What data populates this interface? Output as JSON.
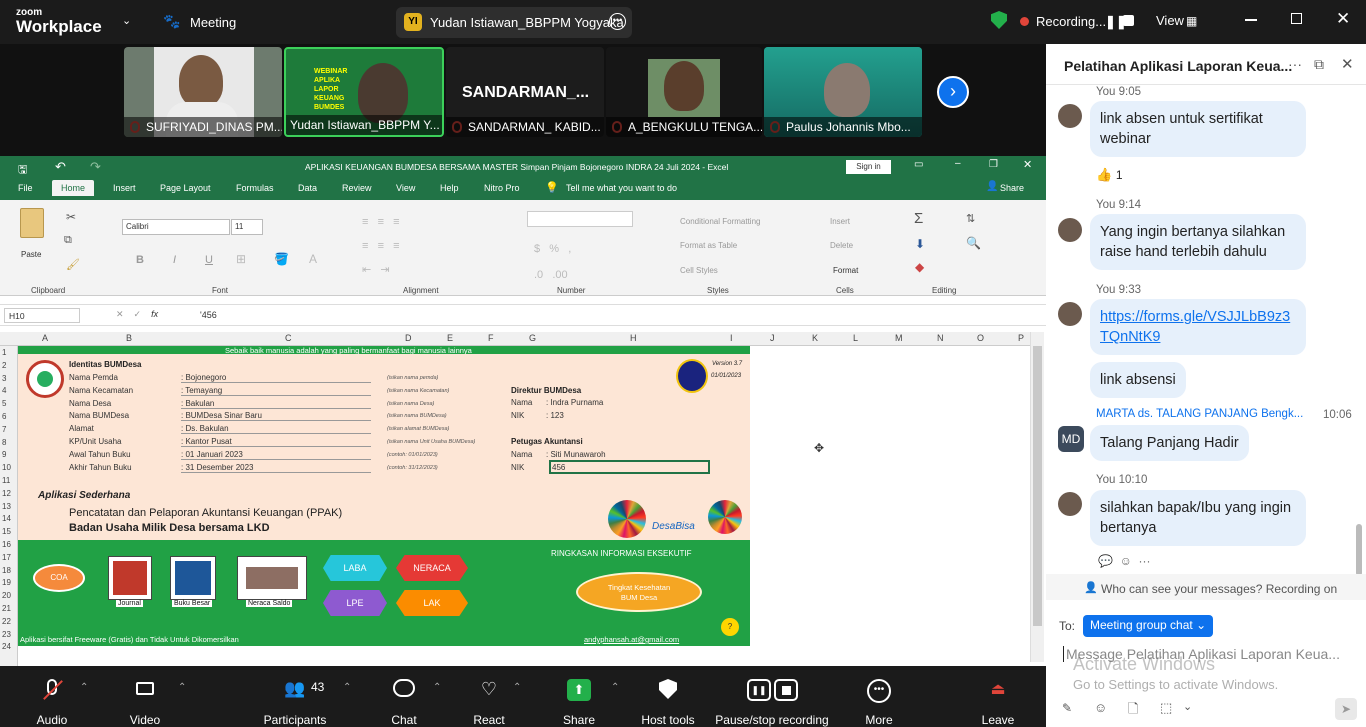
{
  "app": {
    "logo_top": "zoom",
    "logo_bottom": "Workplace",
    "meeting_label": "Meeting",
    "speaker_initials": "YI",
    "speaker_name": "Yudan Istiawan_BBPPM Yogyaka",
    "recording": "Recording...",
    "view_label": "View"
  },
  "thumbnails": [
    {
      "name": "SUFRIYADI_DINAS PM..."
    },
    {
      "name": "Yudan Istiawan_BBPPM Y..."
    },
    {
      "name": "SANDARMAN_ KABID...",
      "big_name": "SANDARMAN_..."
    },
    {
      "name": "A_BENGKULU TENGA..."
    },
    {
      "name": "Paulus Johannis Mbo..."
    }
  ],
  "excel": {
    "title": "APLIKASI KEUANGAN BUMDESA BERSAMA MASTER  Simpan Pinjam Bojonegoro INDRA 24 Juli 2024  -  Excel",
    "sign_in": "Sign in",
    "tabs": [
      "File",
      "Home",
      "Insert",
      "Page Layout",
      "Formulas",
      "Data",
      "Review",
      "View",
      "Help",
      "Nitro Pro"
    ],
    "tell_me": "Tell me what you want to do",
    "share": "Share",
    "ribbon": {
      "paste": "Paste",
      "font": "Calibri",
      "size": "11",
      "conditional": "Conditional Formatting",
      "format_table": "Format as Table",
      "cell_styles": "Cell Styles",
      "insert": "Insert",
      "delete": "Delete",
      "format": "Format",
      "groups": [
        "Clipboard",
        "Font",
        "Alignment",
        "Number",
        "Styles",
        "Cells",
        "Editing"
      ]
    },
    "name_box": "H10",
    "formula": "'456",
    "columns": [
      "A",
      "B",
      "C",
      "D",
      "E",
      "F",
      "G",
      "H",
      "I",
      "J",
      "K",
      "L",
      "M",
      "N",
      "O",
      "P"
    ],
    "rows": [
      "1",
      "2",
      "3",
      "4",
      "5",
      "6",
      "7",
      "8",
      "9",
      "10",
      "11",
      "12",
      "13",
      "14",
      "15",
      "16",
      "17",
      "18",
      "19",
      "20",
      "21",
      "22",
      "23",
      "24"
    ],
    "motto": "Sebaik baik manusia adalah yang paling bermanfaat bagi manusia lainnya",
    "identitas_title": "Identitas BUMDesa",
    "fields": [
      {
        "label": "Nama Pemda",
        "value": ": Bojonegoro",
        "hint": "(isikan nama pemda)"
      },
      {
        "label": "Nama Kecamatan",
        "value": ": Temayang",
        "hint": "(isikan nama Kecamatan)"
      },
      {
        "label": "Nama Desa",
        "value": ": Bakulan",
        "hint": "(isikan nama Desa)"
      },
      {
        "label": "Nama BUMDesa",
        "value": ": BUMDesa Sinar Baru",
        "hint": "(isikan nama BUMDesa)"
      },
      {
        "label": "Alamat",
        "value": ": Ds. Bakulan",
        "hint": "(isikan alamat BUMDesa)"
      },
      {
        "label": "KP/Unit Usaha",
        "value": ": Kantor Pusat",
        "hint": "(isikan nama Unit Usaha BUMDesa)"
      },
      {
        "label": "Awal Tahun Buku",
        "value": ": 01 Januari 2023",
        "hint": "(contoh: 01/01/2023)"
      },
      {
        "label": "Akhir Tahun Buku",
        "value": ": 31 Desember 2023",
        "hint": "(contoh: 31/12/2023)"
      }
    ],
    "version": "Version 3.7",
    "version_date": "01/01/2023",
    "direktur_title": "Direktur BUMDesa",
    "direktur_nama_label": "Nama",
    "direktur_nama": ":  Indra Purnama",
    "direktur_nik_label": "NIK",
    "direktur_nik": ":  123",
    "petugas_title": "Petugas Akuntansi",
    "petugas_nama_label": "Nama",
    "petugas_nama": ":  Siti Munawaroh",
    "petugas_nik_label": "NIK",
    "petugas_nik": "456",
    "app_sub": "Aplikasi Sederhana",
    "app_line1": "Pencatatan dan Pelaporan Akuntansi Keuangan (PPAK)",
    "app_line2": "Badan Usaha Milik Desa bersama LKD",
    "desa_logo": "DesaBisa",
    "buttons": {
      "coa": "COA",
      "journal": "Journal",
      "buku_besar": "Buku Besar",
      "neraca_saldo": "Neraca Saldo",
      "laba": "LABA",
      "neraca": "NERACA",
      "lpe": "LPE",
      "lak": "LAK"
    },
    "ringkasan": "RINGKASAN INFORMASI EKSEKUTIF",
    "tingkat_line1": "Tingkat Kesehatan",
    "tingkat_line2": "BUM Desa",
    "footer_left": "Aplikasi bersifat Freeware (Gratis) dan Tidak Untuk Dikomersilkan",
    "footer_right": "andyphansah.at@gmail.com"
  },
  "chat": {
    "title": "Pelatihan Aplikasi Laporan Keua...",
    "messages": [
      {
        "time": "You 9:05",
        "text": "link absen untuk sertifikat webinar"
      },
      {
        "reaction": "👍",
        "reaction_count": "1"
      },
      {
        "time": "You 9:14",
        "text": "Yang ingin bertanya silahkan raise hand terlebih dahulu"
      },
      {
        "time": "You 9:33",
        "link": "https://forms.gle/VSJJLbB9z3TQnNtK9",
        "text2": "link absensi"
      },
      {
        "sender": "MARTA ds. TALANG PANJANG Bengk...",
        "time": "10:06",
        "initials": "MD",
        "text": "Talang Panjang Hadir"
      },
      {
        "time": "You 10:10",
        "text": "silahkan bapak/Ibu yang ingin bertanya"
      }
    ],
    "privacy": "Who can see your messages? Recording on",
    "to_label": "To:",
    "to_value": "Meeting group chat",
    "input_placeholder": "Message  Pelatihan Aplikasi Laporan Keua...",
    "watermark1": "Activate Windows",
    "watermark2": "Go to Settings to activate Windows."
  },
  "toolbar": {
    "audio": "Audio",
    "video": "Video",
    "participants": "Participants",
    "participants_count": "43",
    "chat": "Chat",
    "react": "React",
    "share": "Share",
    "host_tools": "Host tools",
    "record": "Pause/stop recording",
    "more": "More",
    "leave": "Leave"
  },
  "colors": {
    "zoom_blue": "#0e72ed",
    "excel_green": "#217346",
    "sheet_green": "#21a145",
    "record_red": "#e0453a",
    "shield_green": "#23b04b"
  }
}
